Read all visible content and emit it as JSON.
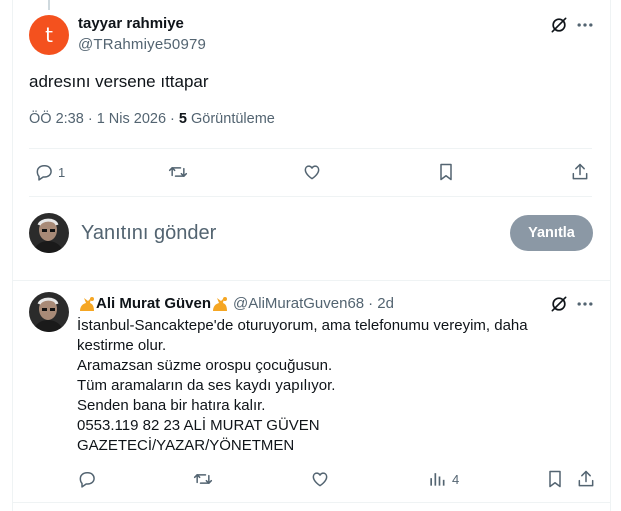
{
  "main_tweet": {
    "avatar_letter": "t",
    "avatar_color": "#f4511e",
    "author_name": "tayyar rahmiye",
    "author_handle": "@TRahmiye50979",
    "text": "adresını versene ıttapar",
    "time": "ÖÖ 2:38 · 1 Nis 2026 · ",
    "views_count": "5",
    "views_label": " Görüntüleme",
    "reply_count": "1"
  },
  "reply_composer": {
    "placeholder": "Yanıtını gönder",
    "button_label": "Yanıtla"
  },
  "comment": {
    "author_name": "Ali Murat Güven",
    "author_handle": "@AliMuratGuven68",
    "age": "· 2d",
    "lines": [
      "İstanbul-Sancaktepe'de oturuyorum, ama telefonumu vereyim, daha",
      "kestirme olur.",
      "Aramazsan süzme orospu çocuğusun.",
      "Tüm aramaların da ses kaydı yapılıyor.",
      "Senden bana bir hatıra kalır.",
      "0553.119 82 23 ALİ MURAT GÜVEN",
      "GAZETECİ/YAZAR/YÖNETMEN"
    ],
    "views_count": "4"
  },
  "icons": {
    "grok": "grok-icon",
    "more": "more-icon",
    "reply": "reply-icon",
    "repost": "repost-icon",
    "like": "like-icon",
    "bookmark": "bookmark-icon",
    "share": "share-icon",
    "analytics": "analytics-icon"
  }
}
